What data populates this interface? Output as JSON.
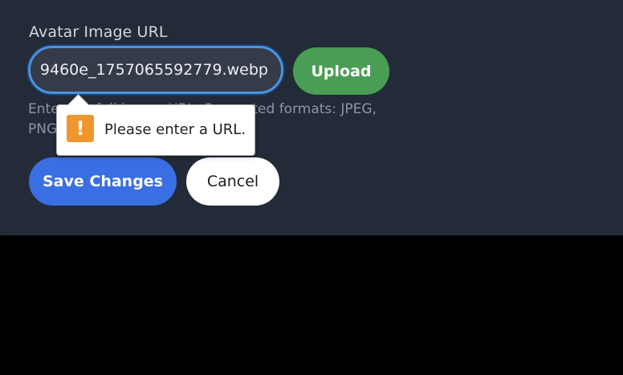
{
  "form": {
    "avatar_label": "Avatar Image URL",
    "avatar_url_value": "9460e_1757065592779.webp",
    "upload_label": "Upload",
    "hint_text": "Enter the full image URL. Supported formats: JPEG, PNG, WebP",
    "save_label": "Save Changes",
    "cancel_label": "Cancel"
  },
  "validation": {
    "message": "Please enter a URL.",
    "icon": "warning-icon",
    "icon_glyph": "!"
  },
  "colors": {
    "panel_bg": "#232a38",
    "focus_ring": "#4b93e0",
    "upload_bg": "#4a9d55",
    "save_bg": "#3a6ee3",
    "warning": "#f0962e"
  }
}
